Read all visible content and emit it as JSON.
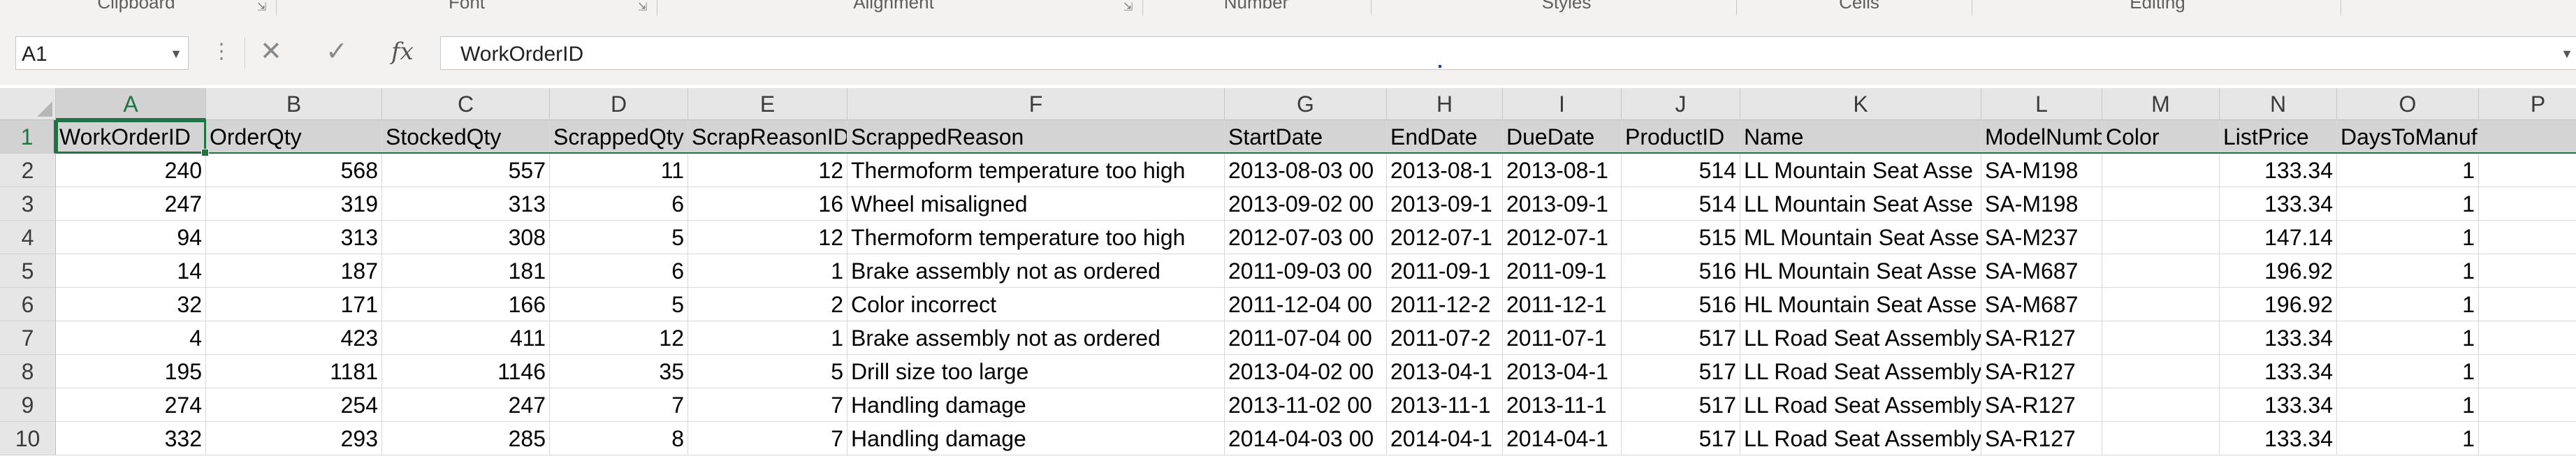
{
  "ribbon": {
    "groups": [
      {
        "label": "Clipboard",
        "center": 195
      },
      {
        "label": "Font",
        "center": 668
      },
      {
        "label": "Alignment",
        "center": 1279
      },
      {
        "label": "Number",
        "center": 1798
      },
      {
        "label": "Styles",
        "center": 2242
      },
      {
        "label": "Cells",
        "center": 2661
      },
      {
        "label": "Editing",
        "center": 3088
      }
    ]
  },
  "formula_bar": {
    "name_box": "A1",
    "dots": "⋮",
    "cancel": "✕",
    "enter": "✓",
    "fx": "fx",
    "content": "WorkOrderID"
  },
  "sheet": {
    "columns": [
      "A",
      "B",
      "C",
      "D",
      "E",
      "F",
      "G",
      "H",
      "I",
      "J",
      "K",
      "L",
      "M",
      "N",
      "O",
      "P"
    ],
    "rows": [
      "1",
      "2",
      "3",
      "4",
      "5",
      "6",
      "7",
      "8",
      "9",
      "10"
    ],
    "header": [
      "WorkOrderID",
      "OrderQty",
      "StockedQty",
      "ScrappedQty",
      "ScrapReasonID",
      "ScrappedReason",
      "StartDate",
      "EndDate",
      "DueDate",
      "ProductID",
      "Name",
      "ModelNumber",
      "Color",
      "ListPrice",
      "DaysToManufacture",
      ""
    ],
    "data": [
      [
        "240",
        "568",
        "557",
        "11",
        "12",
        "Thermoform temperature too high",
        "2013-08-03 00",
        "2013-08-1",
        "2013-08-1",
        "514",
        "LL Mountain Seat Asse",
        "SA-M198",
        "",
        "133.34",
        "1",
        ""
      ],
      [
        "247",
        "319",
        "313",
        "6",
        "16",
        "Wheel misaligned",
        "2013-09-02 00",
        "2013-09-1",
        "2013-09-1",
        "514",
        "LL Mountain Seat Asse",
        "SA-M198",
        "",
        "133.34",
        "1",
        ""
      ],
      [
        "94",
        "313",
        "308",
        "5",
        "12",
        "Thermoform temperature too high",
        "2012-07-03 00",
        "2012-07-1",
        "2012-07-1",
        "515",
        "ML Mountain Seat Asse",
        "SA-M237",
        "",
        "147.14",
        "1",
        ""
      ],
      [
        "14",
        "187",
        "181",
        "6",
        "1",
        "Brake assembly not as ordered",
        "2011-09-03 00",
        "2011-09-1",
        "2011-09-1",
        "516",
        "HL Mountain Seat Asse",
        "SA-M687",
        "",
        "196.92",
        "1",
        ""
      ],
      [
        "32",
        "171",
        "166",
        "5",
        "2",
        "Color incorrect",
        "2011-12-04 00",
        "2011-12-2",
        "2011-12-1",
        "516",
        "HL Mountain Seat Asse",
        "SA-M687",
        "",
        "196.92",
        "1",
        ""
      ],
      [
        "4",
        "423",
        "411",
        "12",
        "1",
        "Brake assembly not as ordered",
        "2011-07-04 00",
        "2011-07-2",
        "2011-07-1",
        "517",
        "LL Road Seat Assembly",
        "SA-R127",
        "",
        "133.34",
        "1",
        ""
      ],
      [
        "195",
        "1181",
        "1146",
        "35",
        "5",
        "Drill size too large",
        "2013-04-02 00",
        "2013-04-1",
        "2013-04-1",
        "517",
        "LL Road Seat Assembly",
        "SA-R127",
        "",
        "133.34",
        "1",
        ""
      ],
      [
        "274",
        "254",
        "247",
        "7",
        "7",
        "Handling damage",
        "2013-11-02 00",
        "2013-11-1",
        "2013-11-1",
        "517",
        "LL Road Seat Assembly",
        "SA-R127",
        "",
        "133.34",
        "1",
        ""
      ],
      [
        "332",
        "293",
        "285",
        "8",
        "7",
        "Handling damage",
        "2014-04-03 00",
        "2014-04-1",
        "2014-04-1",
        "517",
        "LL Road Seat Assembly",
        "SA-R127",
        "",
        "133.34",
        "1",
        ""
      ]
    ]
  }
}
